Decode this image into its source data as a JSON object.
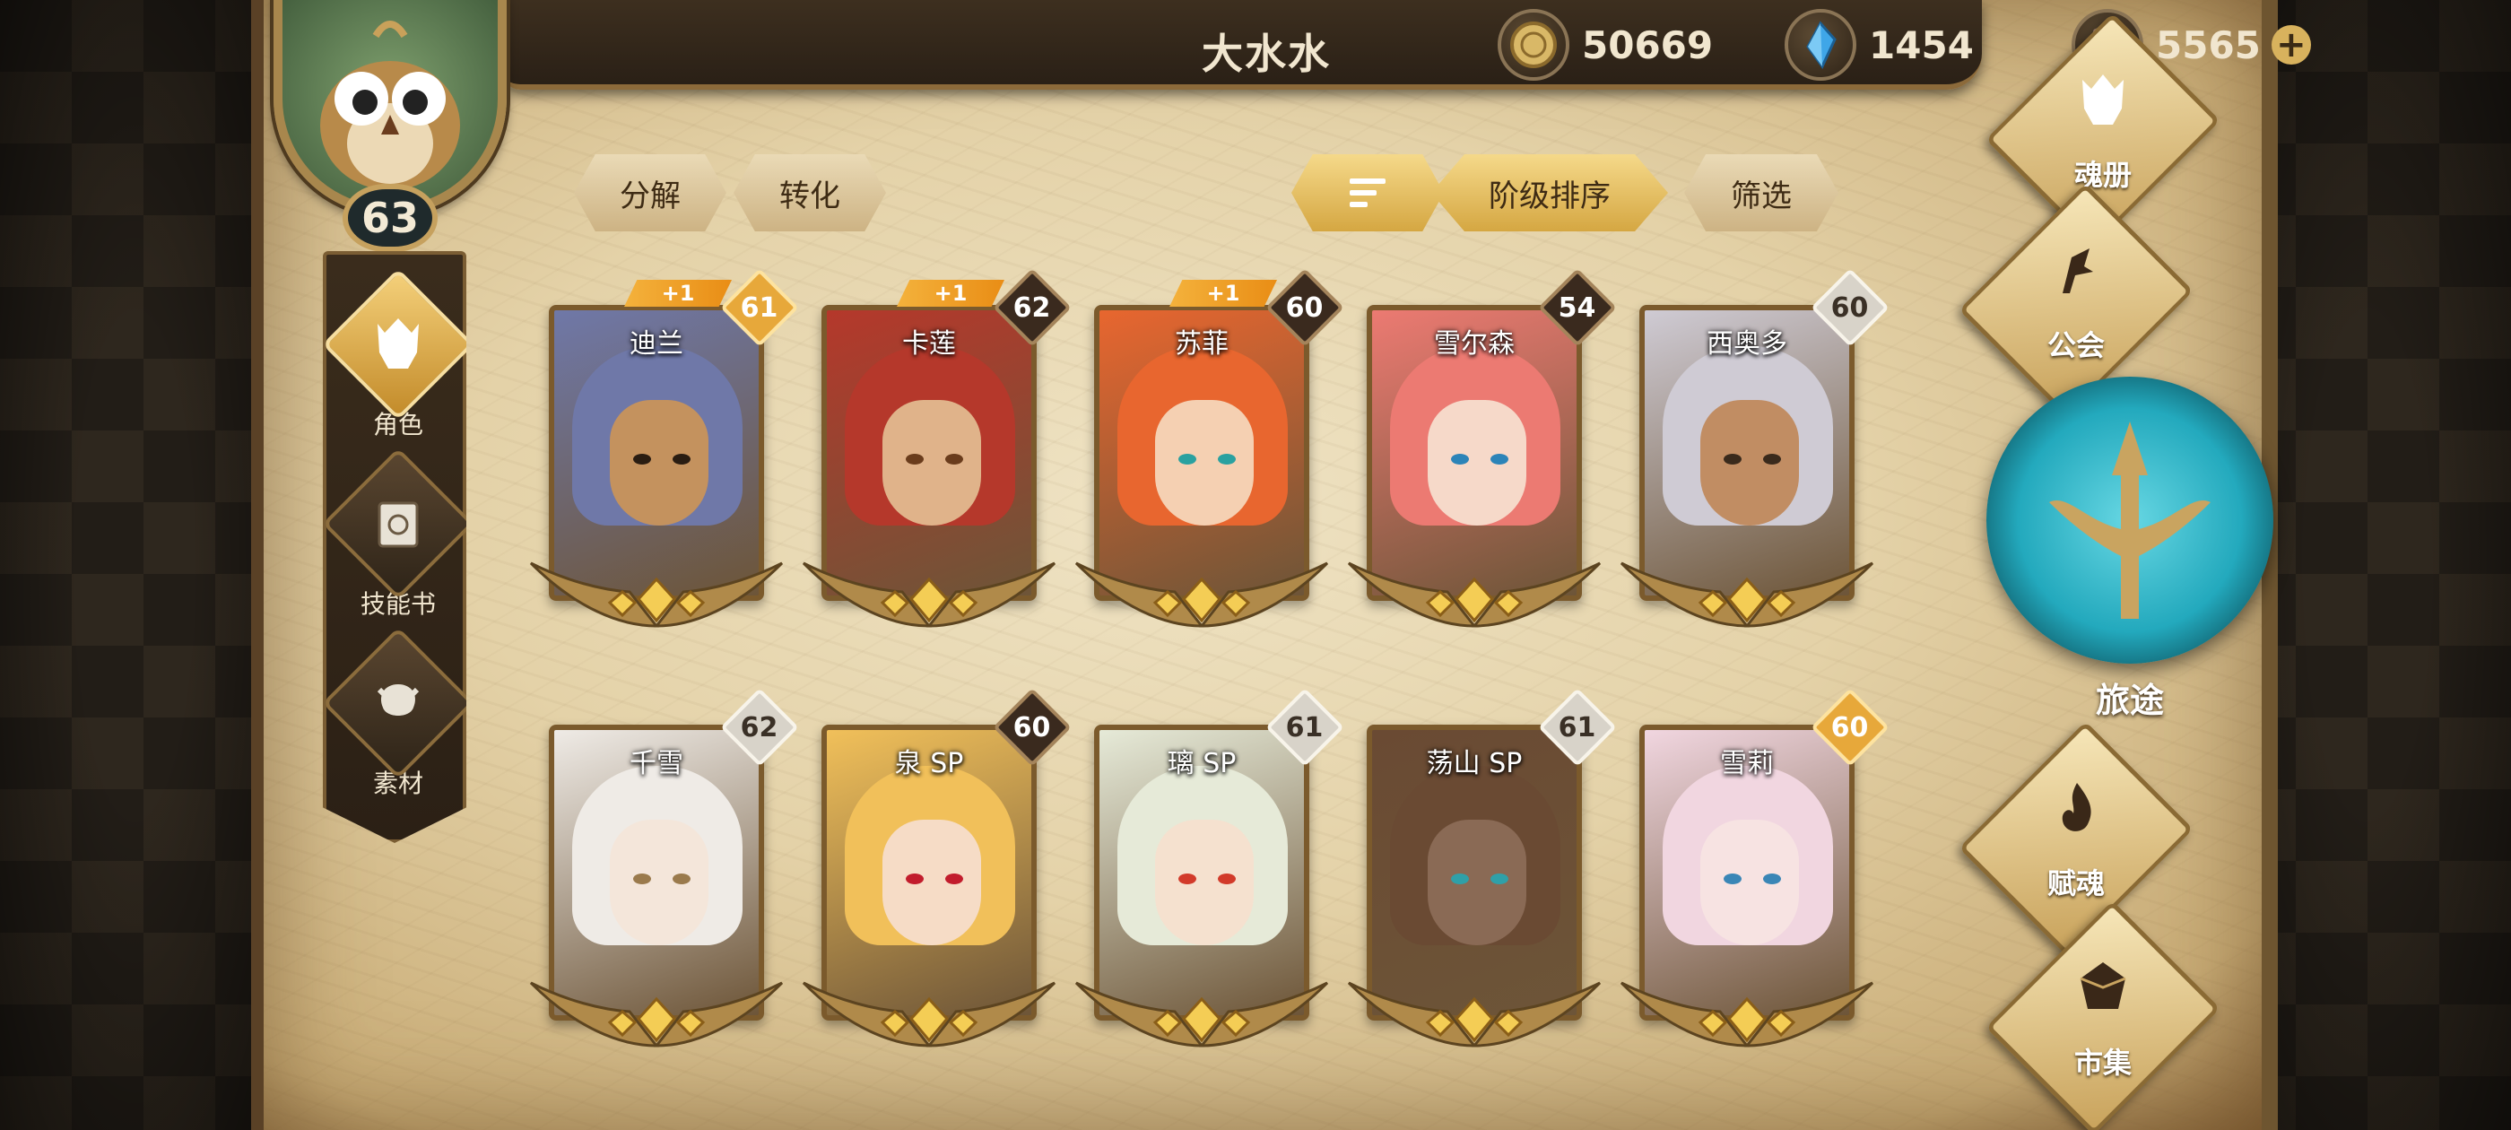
{
  "player": {
    "name": "大水水",
    "level": "63"
  },
  "resources": [
    {
      "name": "gold-coin",
      "value": "50669"
    },
    {
      "name": "blue-crystal",
      "value": "1454"
    },
    {
      "name": "soul-gem",
      "value": "5565",
      "add": "+"
    }
  ],
  "actions": {
    "decompose": "分解",
    "convert": "转化",
    "sort": "阶级排序",
    "filter": "筛选"
  },
  "left_menu": [
    {
      "label": "角色",
      "icon": "helmet-icon",
      "active": true
    },
    {
      "label": "技能书",
      "icon": "skill-book-icon",
      "active": false
    },
    {
      "label": "素材",
      "icon": "material-icon",
      "active": false
    }
  ],
  "heroes": [
    {
      "name": "迪兰",
      "level": "61",
      "badge": "gold",
      "bonus": "+1",
      "hair": "#6f78a8",
      "skin": "#c4925e",
      "eye": "#2a1d12"
    },
    {
      "name": "卡莲",
      "level": "62",
      "badge": "dark",
      "bonus": "+1",
      "hair": "#b5382b",
      "skin": "#e0b38a",
      "eye": "#6a3c1c"
    },
    {
      "name": "苏菲",
      "level": "60",
      "badge": "dark",
      "bonus": "+1",
      "hair": "#e8662f",
      "skin": "#f5d0b2",
      "eye": "#2aa1a0"
    },
    {
      "name": "雪尔森",
      "level": "54",
      "badge": "dark",
      "bonus": "",
      "hair": "#ec7a72",
      "skin": "#f6d9c9",
      "eye": "#2c84b8"
    },
    {
      "name": "西奥多",
      "level": "60",
      "badge": "silver",
      "bonus": "",
      "hair": "#cfcbd4",
      "skin": "#c18d63",
      "eye": "#3a2a1c"
    },
    {
      "name": "千雪",
      "level": "62",
      "badge": "silver",
      "bonus": "",
      "hair": "#efebe6",
      "skin": "#f4e6da",
      "eye": "#9a7a4c"
    },
    {
      "name": "泉 SP",
      "level": "60",
      "badge": "dark",
      "bonus": "",
      "hair": "#f1c05a",
      "skin": "#f6dcc6",
      "eye": "#c21c2c"
    },
    {
      "name": "璃 SP",
      "level": "61",
      "badge": "silver",
      "bonus": "",
      "hair": "#e6ead8",
      "skin": "#f5e1cf",
      "eye": "#d23a2a"
    },
    {
      "name": "荡山 SP",
      "level": "61",
      "badge": "silver",
      "bonus": "",
      "hair": "#6a4a33",
      "skin": "#8a6a55",
      "eye": "#2fa0a8"
    },
    {
      "name": "雪莉",
      "level": "60",
      "badge": "gold",
      "bonus": "",
      "hair": "#f1d6e0",
      "skin": "#f7e3e2",
      "eye": "#3a86b6"
    }
  ],
  "right_menu": {
    "soulbook": "魂册",
    "guild": "公会",
    "journey": "旅途",
    "talent": "赋魂",
    "market": "市集"
  }
}
